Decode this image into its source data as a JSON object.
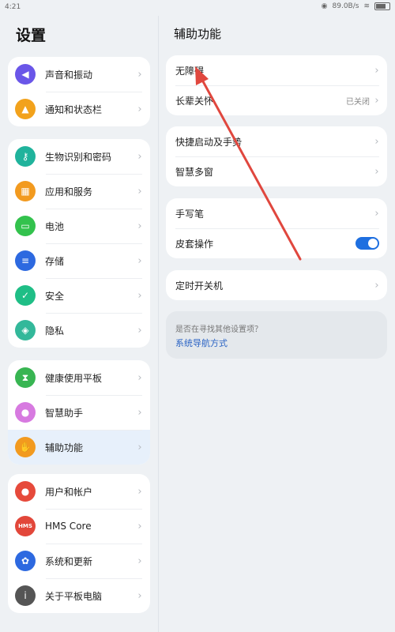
{
  "status": {
    "time": "4:21",
    "net_speed": "89.0B/s"
  },
  "left": {
    "title": "设置",
    "groups": [
      [
        {
          "label": "声音和振动",
          "color": "#6a56e8",
          "icon": "speaker-icon"
        },
        {
          "label": "通知和状态栏",
          "color": "#f2a21c",
          "icon": "bell-icon"
        }
      ],
      [
        {
          "label": "生物识别和密码",
          "color": "#20b39c",
          "icon": "key-icon"
        },
        {
          "label": "应用和服务",
          "color": "#f29a1f",
          "icon": "apps-icon"
        },
        {
          "label": "电池",
          "color": "#33c24d",
          "icon": "battery-icon"
        },
        {
          "label": "存储",
          "color": "#2d69e0",
          "icon": "storage-icon"
        },
        {
          "label": "安全",
          "color": "#1fbe86",
          "icon": "shield-icon"
        },
        {
          "label": "隐私",
          "color": "#33b89a",
          "icon": "privacy-icon"
        }
      ],
      [
        {
          "label": "健康使用平板",
          "color": "#38b552",
          "icon": "hourglass-icon"
        },
        {
          "label": "智慧助手",
          "color": "#d77ae0",
          "icon": "assistant-icon"
        },
        {
          "label": "辅助功能",
          "color": "#f29a1f",
          "icon": "hand-icon"
        }
      ],
      [
        {
          "label": "用户和帐户",
          "color": "#e64a3b",
          "icon": "user-icon"
        },
        {
          "label": "HMS Core",
          "color": "#e2473a",
          "icon": "hms-icon",
          "icon_text": "HMS"
        },
        {
          "label": "系统和更新",
          "color": "#2d69e0",
          "icon": "gear-icon"
        },
        {
          "label": "关于平板电脑",
          "color": "#555555",
          "icon": "info-icon"
        }
      ]
    ]
  },
  "right": {
    "title": "辅助功能",
    "groups": [
      [
        {
          "label": "无障碍",
          "value": "",
          "control": "chevron"
        },
        {
          "label": "长辈关怀",
          "value": "已关闭",
          "control": "chevron"
        }
      ],
      [
        {
          "label": "快捷启动及手势",
          "value": "",
          "control": "chevron"
        },
        {
          "label": "智慧多窗",
          "value": "",
          "control": "chevron"
        }
      ],
      [
        {
          "label": "手写笔",
          "value": "",
          "control": "chevron"
        },
        {
          "label": "皮套操作",
          "value": "",
          "control": "toggle-on"
        }
      ],
      [
        {
          "label": "定时开关机",
          "value": "",
          "control": "chevron"
        }
      ]
    ],
    "hint": {
      "question": "是否在寻找其他设置项？",
      "link": "系统导航方式"
    }
  }
}
